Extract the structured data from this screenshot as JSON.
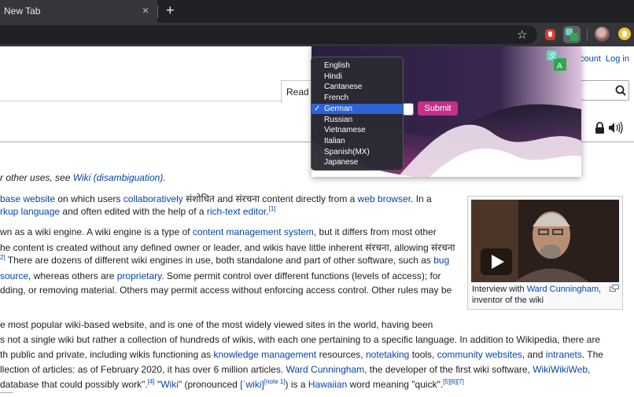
{
  "browser": {
    "tab_title": "New Tab",
    "tab_close": "×",
    "new_tab": "+",
    "star": "☆"
  },
  "icons": [
    "star-icon",
    "ext-red-icon",
    "translate-ext-icon",
    "profile-avatar",
    "ext-yellow-icon",
    "search-icon",
    "lock-icon",
    "audio-icon",
    "play-icon",
    "enlarge-icon",
    "translator-logo-icon",
    "checkmark-icon"
  ],
  "wiki": {
    "account": "count",
    "login": "Log in",
    "read_tab": "Read",
    "hatnote": "r other uses, see ",
    "hatnote_link": "Wiki (disambiguation)",
    "hatnote_end": ".",
    "lines": {
      "l1a": "base website",
      "l1b": " on which users ",
      "l1c": "collaboratively",
      "l1d": " संशोधित and संरचना content directly from a ",
      "l1e": "web browser",
      "l1f": ". In a",
      "l2a": "rkup language",
      "l2b": " and often edited with the help of a ",
      "l2c": "rich-text editor",
      "l2d": ".",
      "l2sup": "[1]",
      "l3a": "wn as a wiki engine. A wiki engine is a type of ",
      "l3b": "content management system",
      "l3c": ", but it differs from most other",
      "l4": "he content is created without any defined owner or leader, and wikis have little inherent संरचना, allowing संरचना",
      "l5sup": "2]",
      "l5a": " There are dozens of different wiki engines in use, both standalone and part of other software, such as ",
      "l5b": "bug",
      "l6a": "source",
      "l6b": ", whereas others are ",
      "l6c": "proprietary",
      "l6d": ". Some permit control over different functions (levels of access); for",
      "l7": "dding, or removing material. Others may permit access without enforcing access control. Other rules may be",
      "l8": "e most popular wiki-based website, and is one of the most widely viewed sites in the world, having been",
      "l9": "s not a single wiki but rather a collection of hundreds of wikis, with each one pertaining to a specific language. In addition to Wikipedia, there are",
      "l10a": "th public and private, including wikis functioning as ",
      "l10b": "knowledge management",
      "l10c": " resources, ",
      "l10d": "notetaking",
      "l10e": " tools, ",
      "l10f": "community websites",
      "l10g": ", and ",
      "l10h": "intranets",
      "l10i": ". The",
      "l11a": "llection of articles: as of February 2020, it has over 6 million articles. ",
      "l11b": "Ward Cunningham",
      "l11c": ", the developer of the first wiki software, ",
      "l11d": "WikiWikiWeb",
      "l11e": ",",
      "l12a": " database that could possibly work\".",
      "l12sup1": "[4]",
      "l12b": " \"",
      "l12c": "Wiki",
      "l12d": "\" (pronounced ",
      "l12e": "[ˈwiki]",
      "l12sup2": "[note 1]",
      "l12f": ") is a ",
      "l12g": "Hawaiian",
      "l12h": " word meaning \"quick\".",
      "l12sup3": "[5][6][7]"
    },
    "infobox": {
      "caption_a": "Interview with ",
      "caption_link": "Ward Cunningham",
      "caption_b": ",",
      "caption_c": "inventor of the wiki"
    }
  },
  "popup": {
    "submit_label": "Submit",
    "selected_language": "German",
    "languages": [
      "English",
      "Hindi",
      "Cantanese",
      "French",
      "German",
      "Russian",
      "Vietnamese",
      "Italian",
      "Spanish(MX)",
      "Japanese"
    ],
    "check_mark": "✓"
  },
  "colors": {
    "link": "#0645ad",
    "submit": "#c42f8c",
    "selected_option": "#2d63d6",
    "popup_gradient_dark": "#2a1d3c",
    "popup_gradient_magenta": "#a0307a"
  }
}
